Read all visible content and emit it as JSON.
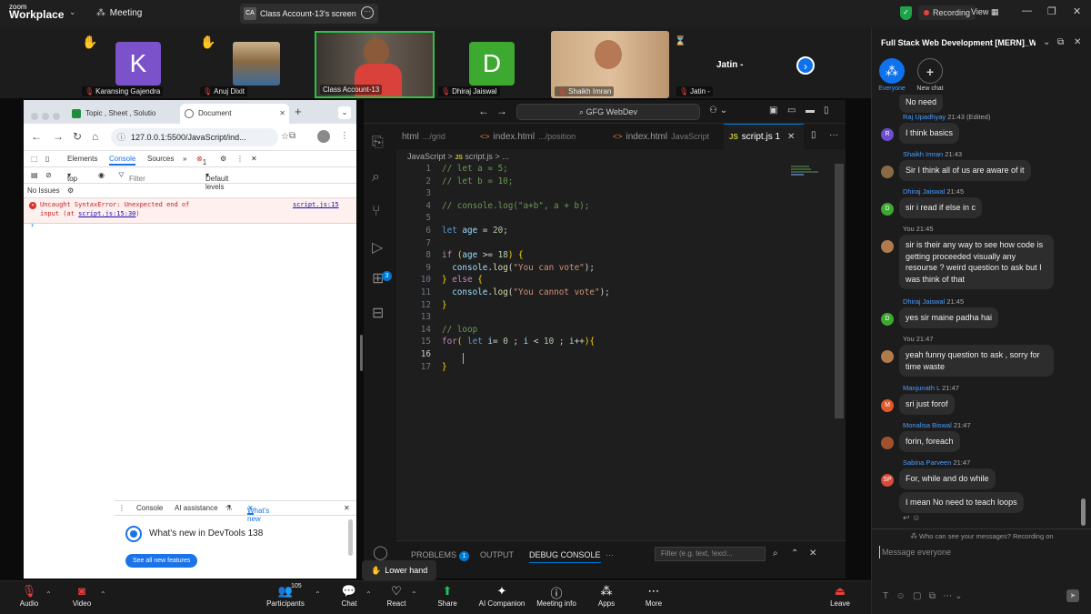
{
  "topbar": {
    "brand_small": "zoom",
    "brand": "Workplace",
    "meeting_label": "Meeting",
    "share_initials": "CA",
    "share_title": "Class Account-13's screen",
    "recording": "Recording",
    "view": "View"
  },
  "gallery": {
    "participants": [
      {
        "name": "Karansing Gajendra",
        "initial": "K",
        "color": "#7b52c9"
      },
      {
        "name": "Anuj Dixit"
      },
      {
        "name": "Class Account-13"
      },
      {
        "name": "Dhiraj Jaiswal",
        "initial": "D",
        "color": "#3da930"
      },
      {
        "name": "Shaikh Imran"
      },
      {
        "name": "Jatin -"
      }
    ],
    "jatin_label": "Jatin -"
  },
  "chrome": {
    "tab1": "Topic , Sheet , Solutio",
    "tab2": "Document",
    "url": "127.0.0.1:5500/JavaScript/ind...",
    "devtools": {
      "tabs": [
        "Elements",
        "Console",
        "Sources",
        "»"
      ],
      "error_count": "1",
      "context": "top",
      "filter_placeholder": "Filter",
      "levels": "Default levels",
      "issues": "No Issues",
      "error_line1": "Uncaught SyntaxError: Unexpected end of",
      "error_line2a": "input (at ",
      "error_link2": "script.js:15:30",
      "error_line2b": ")",
      "error_source": "script.js:15",
      "prompt": "›"
    },
    "drawer": {
      "tabs": [
        "Console",
        "AI assistance",
        "What's new"
      ],
      "whats_new_title": "What's new in DevTools 138",
      "see_all": "See all new features"
    }
  },
  "vscode": {
    "search": "GFG WebDev",
    "tabs": [
      {
        "label": "html",
        "dim": ".../grid"
      },
      {
        "label": "index.html",
        "dim": ".../position"
      },
      {
        "label": "index.html",
        "dim": "JavaScript"
      },
      {
        "label": "script.js 1",
        "lang": "JS"
      }
    ],
    "breadcrumb": {
      "folder": "JavaScript",
      "sep": ">",
      "lang": "JS",
      "file": "script.js",
      "tail": "> ..."
    },
    "line_numbers": [
      "1",
      "2",
      "3",
      "4",
      "5",
      "6",
      "7",
      "8",
      "9",
      "10",
      "11",
      "12",
      "13",
      "14",
      "15",
      "16",
      "17"
    ],
    "panel": {
      "problems": "PROBLEMS",
      "problems_count": "1",
      "output": "OUTPUT",
      "debug": "DEBUG CONSOLE",
      "filter": "Filter (e.g. text, !excl..."
    }
  },
  "lower_hand": "Lower hand",
  "toolbar": {
    "audio": "Audio",
    "video": "Video",
    "participants": "Participants",
    "participant_count": "105",
    "chat": "Chat",
    "react": "React",
    "share": "Share",
    "ai": "AI Companion",
    "info": "Meeting info",
    "apps": "Apps",
    "more": "More",
    "leave": "Leave"
  },
  "chat": {
    "title": "Full Stack Web Development [MERN]_Wee...",
    "everyone": "Everyone",
    "new_chat": "New chat",
    "messages": [
      {
        "name": "",
        "time": "",
        "text": "No need",
        "initial": "",
        "color": ""
      },
      {
        "name": "Raj Upadhyay",
        "time": "21:43 (Edited)",
        "text": "I think basics",
        "initial": "R",
        "color": "#6b4fcf"
      },
      {
        "name": "Shaikh Imran",
        "time": "21:43",
        "text": "Sir I think all of us are aware of it",
        "initial": "",
        "color": "#8a6a45"
      },
      {
        "name": "Dhiraj Jaiswal",
        "time": "21:45",
        "text": "sir i read if else in c",
        "initial": "D",
        "color": "#3da930"
      },
      {
        "name": "You",
        "time": "21:45",
        "text": "sir is their any way to see how code is getting proceeded visually any resourse ? weird question to ask but I was think of that",
        "initial": "",
        "color": "#b07a4a"
      },
      {
        "name": "Dhiraj Jaiswal",
        "time": "21:45",
        "text": "yes sir maine padha hai",
        "initial": "D",
        "color": "#3da930"
      },
      {
        "name": "You",
        "time": "21:47",
        "text": "yeah funny question to ask , sorry for time waste",
        "initial": "",
        "color": "#b07a4a"
      },
      {
        "name": "Manjunath L",
        "time": "21:47",
        "text": "sri just forof",
        "initial": "M",
        "color": "#e05a2b"
      },
      {
        "name": "Monalisa Biswal",
        "time": "21:47",
        "text": "forin, foreach",
        "initial": "",
        "color": "#a0522d"
      },
      {
        "name": "Sabina Parveen",
        "time": "21:47",
        "text": "For, while and do while",
        "initial": "SP",
        "color": "#d84a3a"
      },
      {
        "name": "",
        "time": "",
        "text": "I mean No need to teach loops",
        "initial": "",
        "color": ""
      }
    ],
    "who_can_see": "Who can see your messages? Recording on",
    "input_placeholder": "Message everyone"
  }
}
